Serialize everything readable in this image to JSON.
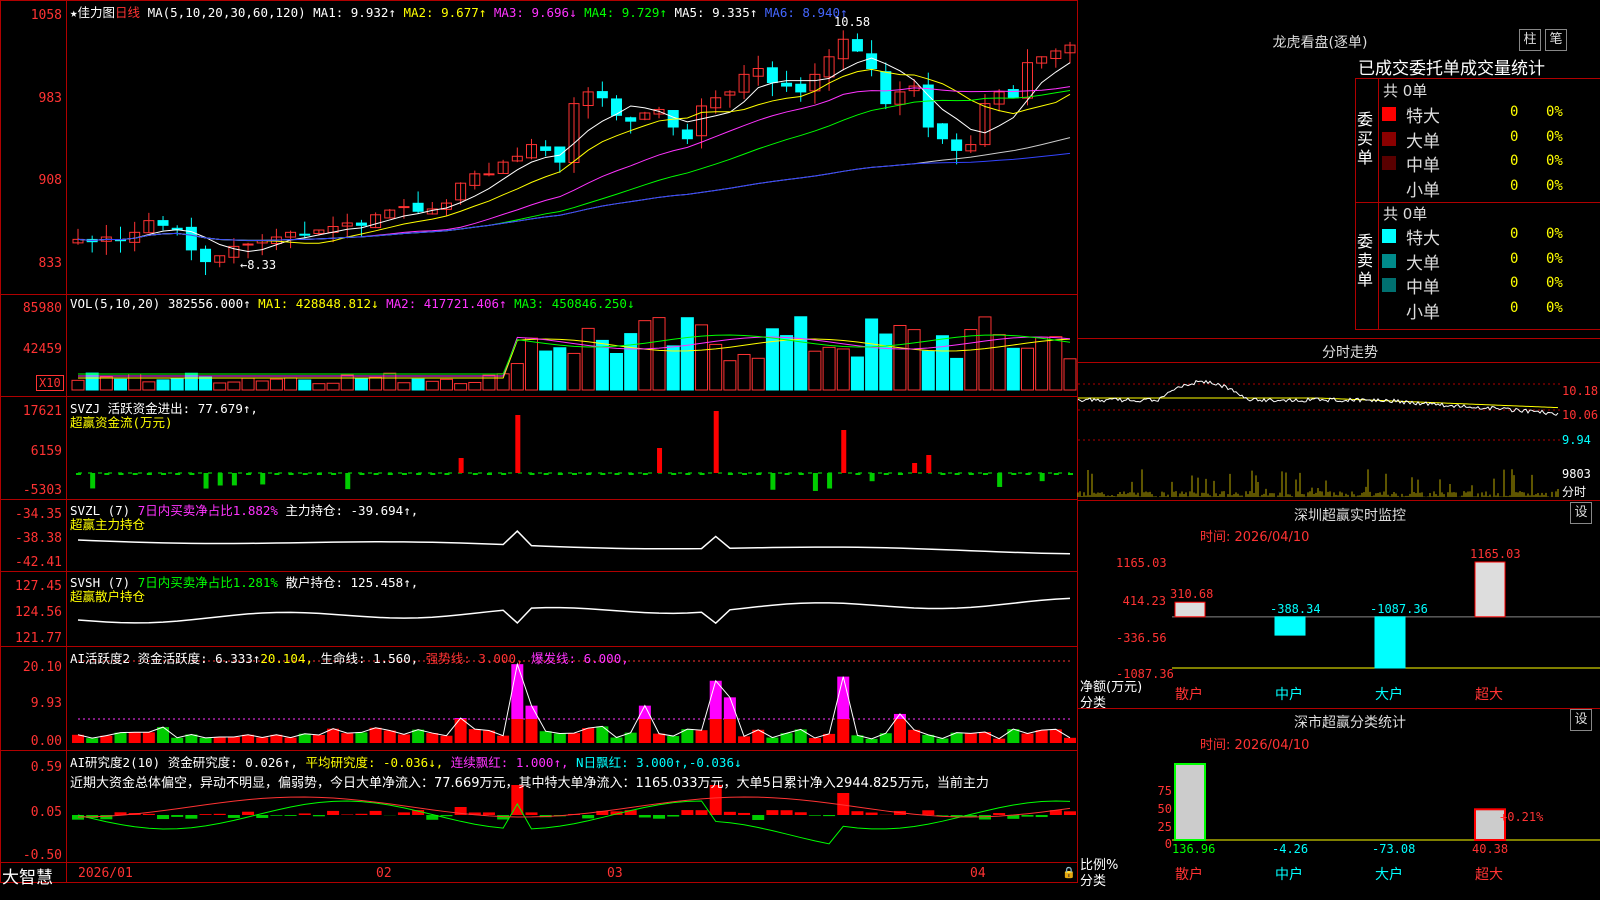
{
  "main_header": {
    "name": "★佳力图",
    "period": "日线",
    "ma_label": "MA(5,10,20,30,60,120)",
    "ma1": "MA1: 9.932↑",
    "ma2": "MA2: 9.677↑",
    "ma3": "MA3: 9.696↓",
    "ma4": "MA4: 9.729↑",
    "ma5": "MA5: 9.335↑",
    "ma6": "MA6: 8.940↑",
    "high_mark": "10.58",
    "low_mark": "←8.33",
    "axis": [
      "1058",
      "983",
      "908",
      "833"
    ]
  },
  "vol_panel": {
    "label": "VOL(5,10,20)",
    "value": "382556.000↑",
    "ma1": "MA1: 428848.812↓",
    "ma2": "MA2: 417721.406↑",
    "ma3": "MA3: 450846.250↓",
    "axis": [
      "85980",
      "42459"
    ],
    "unit": "X10"
  },
  "svzj_panel": {
    "label": "SVZJ",
    "title": "活跃资金进出: 77.679↑,",
    "subtitle": "超赢资金流(万元)",
    "axis": [
      "17621",
      "6159",
      "-5303"
    ]
  },
  "svzl_panel": {
    "label": "SVZL (7)",
    "ratio": "7日内买卖净占比1.882%",
    "hold": "主力持仓: -39.694↑,",
    "subtitle": "超赢主力持仓",
    "axis": [
      "-34.35",
      "-38.38",
      "-42.41"
    ]
  },
  "svsh_panel": {
    "label": "SVSH (7)",
    "ratio": "7日内买卖净占比1.281%",
    "hold": "散户持仓: 125.458↑,",
    "subtitle": "超赢散户持仓",
    "axis": [
      "127.45",
      "124.56",
      "121.77"
    ]
  },
  "ai_active": {
    "label": "AI活跃度2",
    "v1": "资金活跃度: 6.333↑",
    "v2": "20.104,",
    "v3": "生命线: 1.560,",
    "v4": "强势线: 3.000,",
    "v5": "爆发线: 6.000,",
    "axis": [
      "20.10",
      "9.93",
      "0.00"
    ]
  },
  "ai_research": {
    "label": "AI研究度2(10)",
    "v1": "资金研究度: 0.026↑,",
    "v2": "平均研究度: -0.036↓,",
    "v3": "连续飘红: 1.000↑,",
    "v4": "N日飘红: 3.000↑,",
    "v5": "-0.036↓",
    "comment": "近期大资金总体偏空，异动不明显，偏弱势，今日大单净流入：77.669万元，其中特大单净流入：1165.033万元，大单5日累计净入2944.825万元，当前主力",
    "axis": [
      "0.59",
      "0.05",
      "-0.50"
    ]
  },
  "bottom_bar": {
    "brand": "大智慧",
    "dates": [
      "2026/01",
      "02",
      "03",
      "04"
    ]
  },
  "lhb": {
    "title": "龙虎看盘(逐单)",
    "btn_zhu": "柱",
    "btn_bi": "笔",
    "header": "已成交委托单成交量统计",
    "buy_label": "委买单",
    "sell_label": "委卖单",
    "buy_total": "共 0单",
    "sell_total": "共 0单",
    "buy_rows": [
      {
        "name": "特大",
        "n": "0",
        "p": "0%",
        "color": "#ff0000"
      },
      {
        "name": "大单",
        "n": "0",
        "p": "0%",
        "color": "#8b0000"
      },
      {
        "name": "中单",
        "n": "0",
        "p": "0%",
        "color": "#5a0000"
      },
      {
        "name": "小单",
        "n": "0",
        "p": "0%",
        "color": "#000000"
      }
    ],
    "sell_rows": [
      {
        "name": "特大",
        "n": "0",
        "p": "0%",
        "color": "#00ffff"
      },
      {
        "name": "大单",
        "n": "0",
        "p": "0%",
        "color": "#008b8b"
      },
      {
        "name": "中单",
        "n": "0",
        "p": "0%",
        "color": "#007070"
      },
      {
        "name": "小单",
        "n": "0",
        "p": "0%",
        "color": "#000000"
      }
    ]
  },
  "intraday": {
    "title": "分时走势",
    "axis": [
      "10.18",
      "10.06",
      "9.94",
      "9803"
    ],
    "unit": "分时"
  },
  "sz_monitor": {
    "title": "深圳超赢实时监控",
    "btn": "设",
    "time": "时间: 2026/04/10",
    "axis": [
      "1165.03",
      "414.23",
      "-336.56",
      "-1087.36"
    ],
    "ylabel": "净额(万元)",
    "xlabel": "分类",
    "categories": [
      "散户",
      "中户",
      "大户",
      "超大"
    ],
    "values": [
      310.68,
      -388.34,
      -1087.36,
      1165.03
    ],
    "labels": [
      "310.68",
      "-388.34",
      "-1087.36",
      "1165.03"
    ]
  },
  "sz_stats": {
    "title": "深市超赢分类统计",
    "btn": "设",
    "time": "时间: 2026/04/10",
    "axis": [
      "75",
      "50",
      "25",
      "0"
    ],
    "ylabel": "比例%",
    "xlabel": "分类",
    "categories": [
      "散户",
      "中户",
      "大户",
      "超大"
    ],
    "labels": [
      "136.96",
      "-4.26",
      "-73.08",
      "40.38"
    ],
    "top_label": "+0.21%",
    "values": [
      136.96,
      -4.26,
      -73.08,
      40.38
    ]
  },
  "colors": {
    "up": "#ff3333",
    "down": "#00ffff",
    "grid": "#b00000"
  },
  "chart_data": {
    "type": "line",
    "title": "佳力图 日线",
    "candles_close": [
      8.64,
      8.62,
      8.66,
      8.63,
      8.7,
      8.8,
      8.76,
      8.72,
      8.55,
      8.45,
      8.5,
      8.58,
      8.6,
      8.63,
      8.66,
      8.7,
      8.68,
      8.72,
      8.75,
      8.78,
      8.76,
      8.85,
      8.89,
      8.92,
      8.88,
      8.9,
      8.95,
      9.12,
      9.2,
      9.2,
      9.3,
      9.35,
      9.45,
      9.4,
      9.3,
      9.8,
      9.9,
      9.85,
      9.7,
      9.65,
      9.72,
      9.75,
      9.6,
      9.5,
      9.78,
      9.85,
      9.9,
      10.05,
      10.1,
      9.98,
      9.95,
      9.9,
      10.05,
      10.2,
      10.35,
      10.25,
      10.1,
      9.8,
      9.9,
      9.95,
      9.6,
      9.5,
      9.4,
      9.45,
      9.8,
      9.9,
      9.85,
      10.15,
      10.2,
      10.25,
      10.3
    ],
    "ylim": [
      8.25,
      10.6
    ]
  }
}
